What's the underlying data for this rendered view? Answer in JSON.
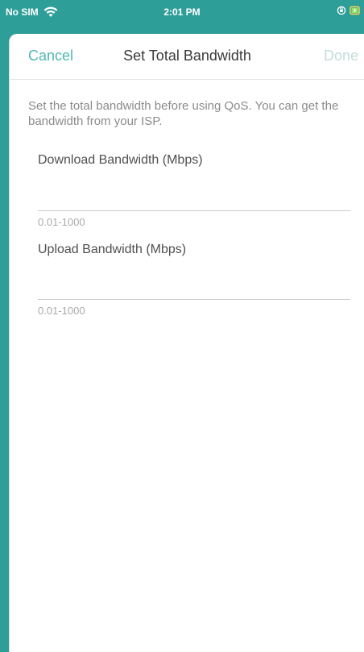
{
  "status_bar": {
    "carrier": "No SIM",
    "time": "2:01 PM"
  },
  "nav": {
    "cancel_label": "Cancel",
    "title": "Set Total Bandwidth",
    "done_label": "Done"
  },
  "description": "Set the total bandwidth before using QoS. You can get the bandwidth from your ISP.",
  "download": {
    "label": "Download Bandwidth (Mbps)",
    "value": "",
    "hint": "0.01-1000"
  },
  "upload": {
    "label": "Upload Bandwidth (Mbps)",
    "value": "",
    "hint": "0.01-1000"
  },
  "colors": {
    "header_bg": "#2e9e98",
    "accent": "#4fb7b1",
    "disabled": "#c3ddda"
  }
}
